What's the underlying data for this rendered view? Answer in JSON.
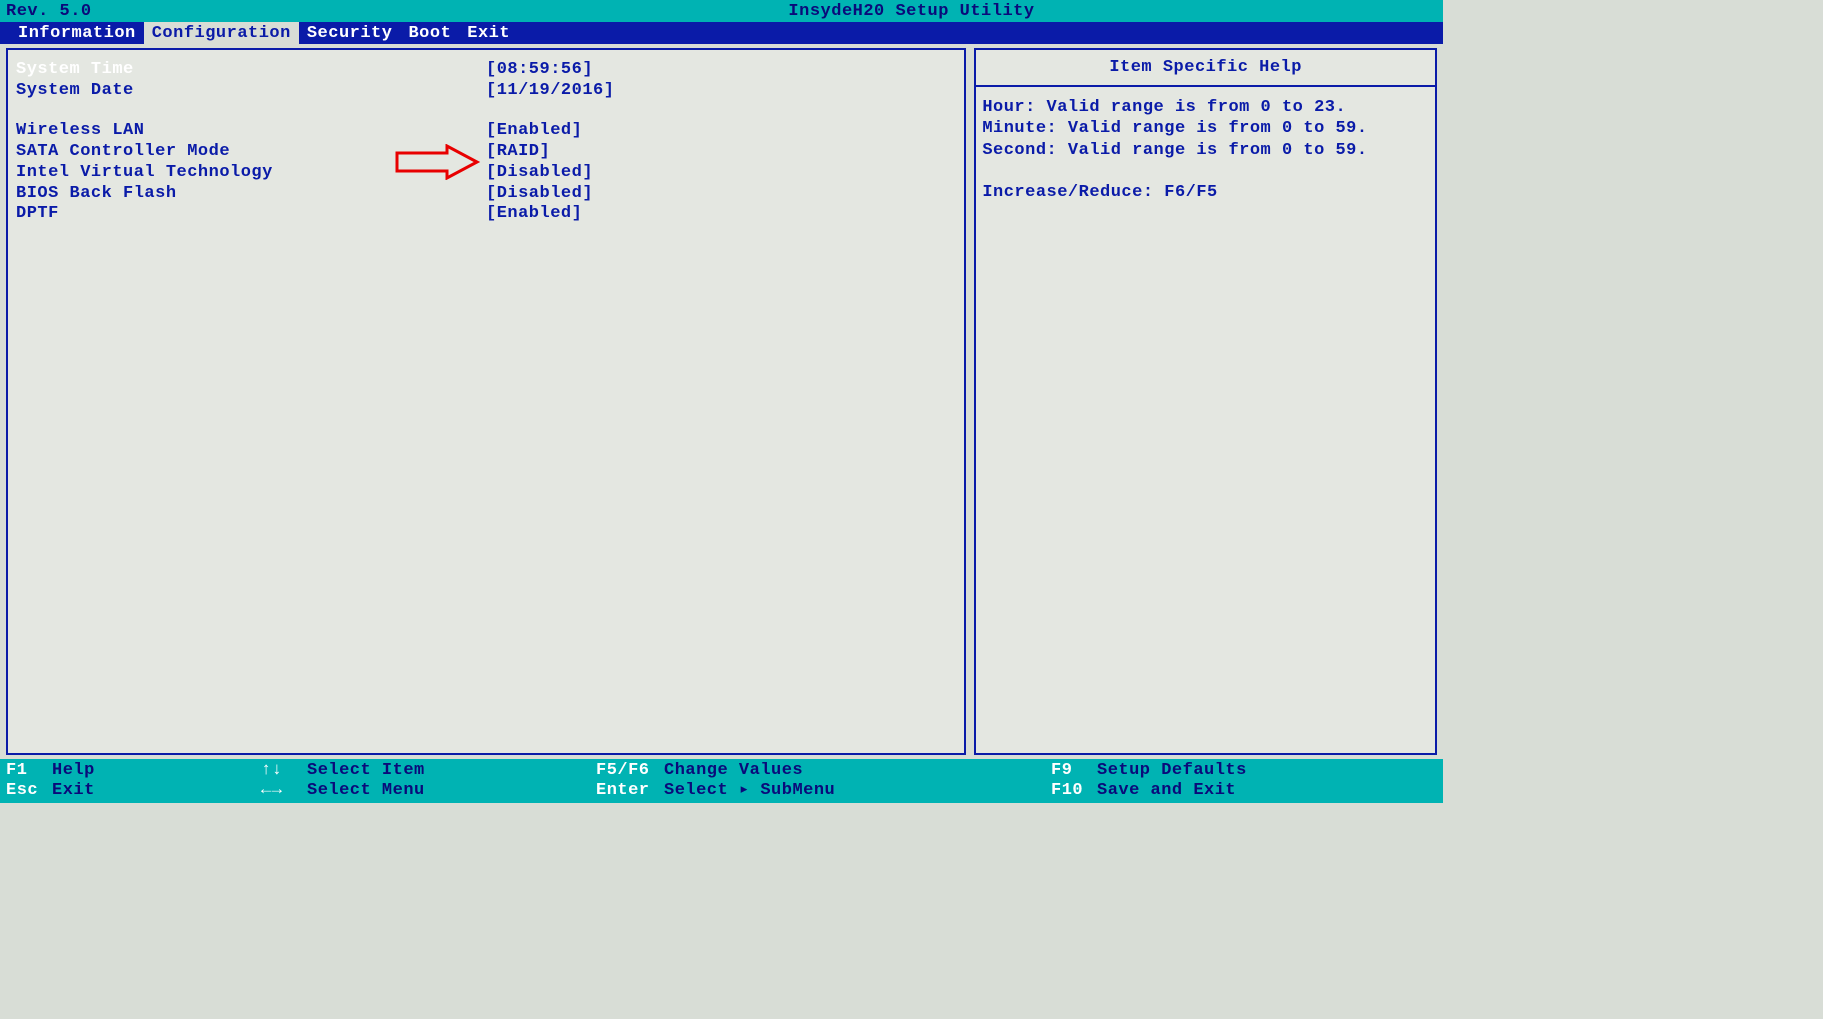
{
  "header": {
    "title": "InsydeH20 Setup Utility",
    "revision": "Rev. 5.0"
  },
  "menu": {
    "items": [
      {
        "label": "Information"
      },
      {
        "label": "Configuration"
      },
      {
        "label": "Security"
      },
      {
        "label": "Boot"
      },
      {
        "label": "Exit"
      }
    ],
    "active_index": 1
  },
  "config": {
    "rows": [
      {
        "label": "System Time",
        "value": "[08:59:56]",
        "selected": true
      },
      {
        "label": "System Date",
        "value": "[11/19/2016]"
      }
    ],
    "rows2": [
      {
        "label": "Wireless LAN",
        "value": "[Enabled]"
      },
      {
        "label": "SATA Controller Mode",
        "value": "[RAID]"
      },
      {
        "label": "Intel Virtual Technology",
        "value": "[Disabled]"
      },
      {
        "label": "BIOS Back Flash",
        "value": "[Disabled]"
      },
      {
        "label": "DPTF",
        "value": "[Enabled]"
      }
    ]
  },
  "help": {
    "title": "Item Specific Help",
    "lines": [
      "Hour: Valid range is from 0 to 23.",
      "Minute: Valid range is from 0 to 59.",
      "Second: Valid range is from 0 to 59.",
      "",
      "Increase/Reduce: F6/F5"
    ]
  },
  "footer": {
    "col1": [
      {
        "key": "F1",
        "text": "Help"
      },
      {
        "key": "Esc",
        "text": "Exit"
      }
    ],
    "col2": [
      {
        "key": "↑↓",
        "text": "Select Item"
      },
      {
        "key": "←→",
        "text": "Select Menu"
      }
    ],
    "col3": [
      {
        "key": "F5/F6",
        "text": "Change Values"
      },
      {
        "key": "Enter",
        "text": "Select ▸ SubMenu"
      }
    ],
    "col4": [
      {
        "key": "F9",
        "text": "Setup Defaults"
      },
      {
        "key": "F10",
        "text": "Save and Exit"
      }
    ]
  }
}
